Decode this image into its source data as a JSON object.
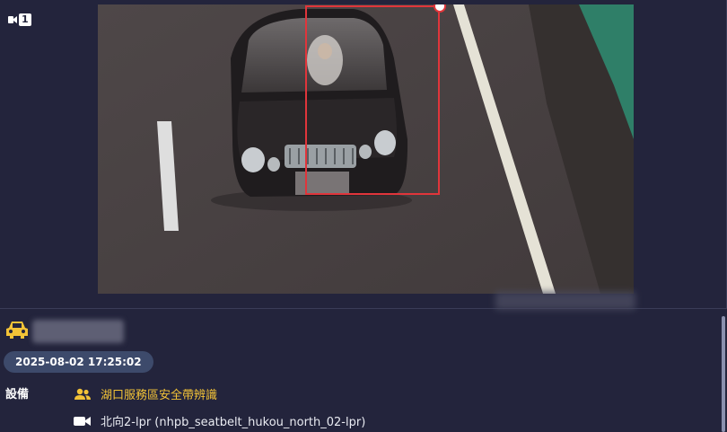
{
  "camera": {
    "badge_number": "1",
    "icon": "video-camera-icon"
  },
  "record": {
    "timestamp": "2025-08-02 17:25:02",
    "device_label": "設備",
    "device_group": "湖口服務區安全帶辨識",
    "device_camera": "北向2-lpr (nhpb_seatbelt_hukou_north_02-lpr)"
  },
  "colors": {
    "background": "#23243c",
    "accent_yellow": "#f3c337",
    "pill": "#3d4a6b",
    "detection_box": "#e0353b"
  }
}
